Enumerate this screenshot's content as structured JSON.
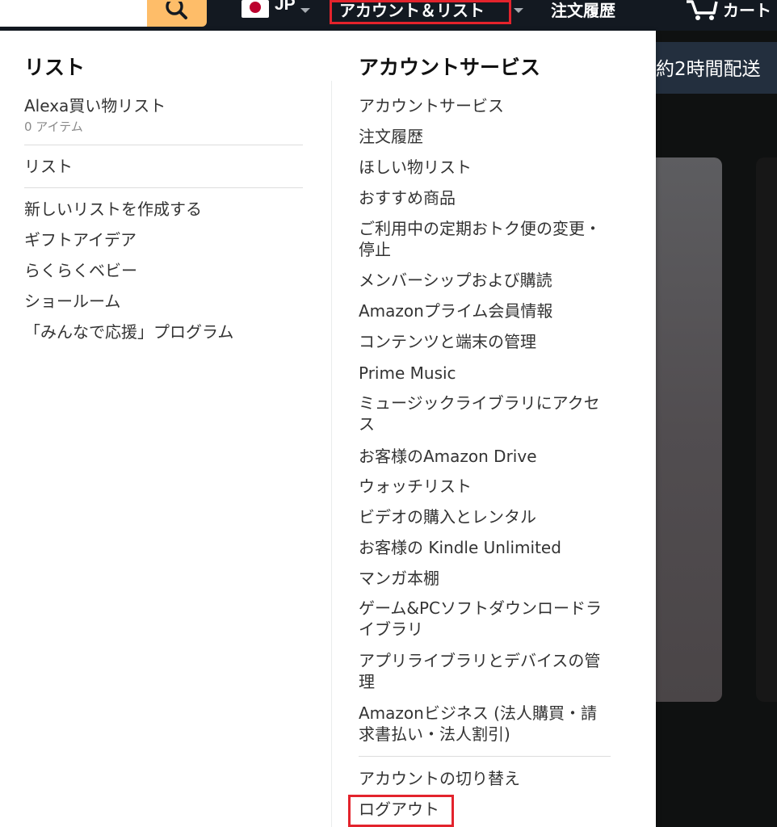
{
  "header": {
    "country_code": "JP",
    "account_label": "アカウント＆リスト",
    "orders_label": "注文履歴",
    "cart_label": "カート"
  },
  "background": {
    "delivery_banner_text": "約2時間配送"
  },
  "lists_column": {
    "title": "リスト",
    "alexa_list": {
      "label": "Alexa買い物リスト",
      "count": "0 アイテム"
    },
    "my_list": "リスト",
    "items": [
      "新しいリストを作成する",
      "ギフトアイデア",
      "らくらくベビー",
      "ショールーム",
      "「みんなで応援」プログラム"
    ]
  },
  "account_column": {
    "title": "アカウントサービス",
    "items": [
      "アカウントサービス",
      "注文履歴",
      "ほしい物リスト",
      "おすすめ商品",
      "ご利用中の定期おトク便の変更・停止",
      "メンバーシップおよび購読",
      "Amazonプライム会員情報",
      "コンテンツと端末の管理",
      "Prime Music",
      "ミュージックライブラリにアクセス",
      "お客様のAmazon Drive",
      "ウォッチリスト",
      "ビデオの購入とレンタル",
      "お客様の Kindle Unlimited",
      "マンガ本棚",
      "ゲーム&PCソフトダウンロードライブラリ",
      "アプリライブラリとデバイスの管理",
      "Amazonビジネス (法人購買・請求書払い・法人割引)"
    ],
    "switch_account": "アカウントの切り替え",
    "logout": "ログアウト"
  },
  "colors": {
    "header_bg": "#131921",
    "search_button": "#febd69",
    "highlight_border": "#e3232c",
    "flyout_bg": "#ffffff"
  },
  "icons": [
    "search-icon",
    "jp-flag-icon",
    "caret-down-icon",
    "cart-icon"
  ]
}
